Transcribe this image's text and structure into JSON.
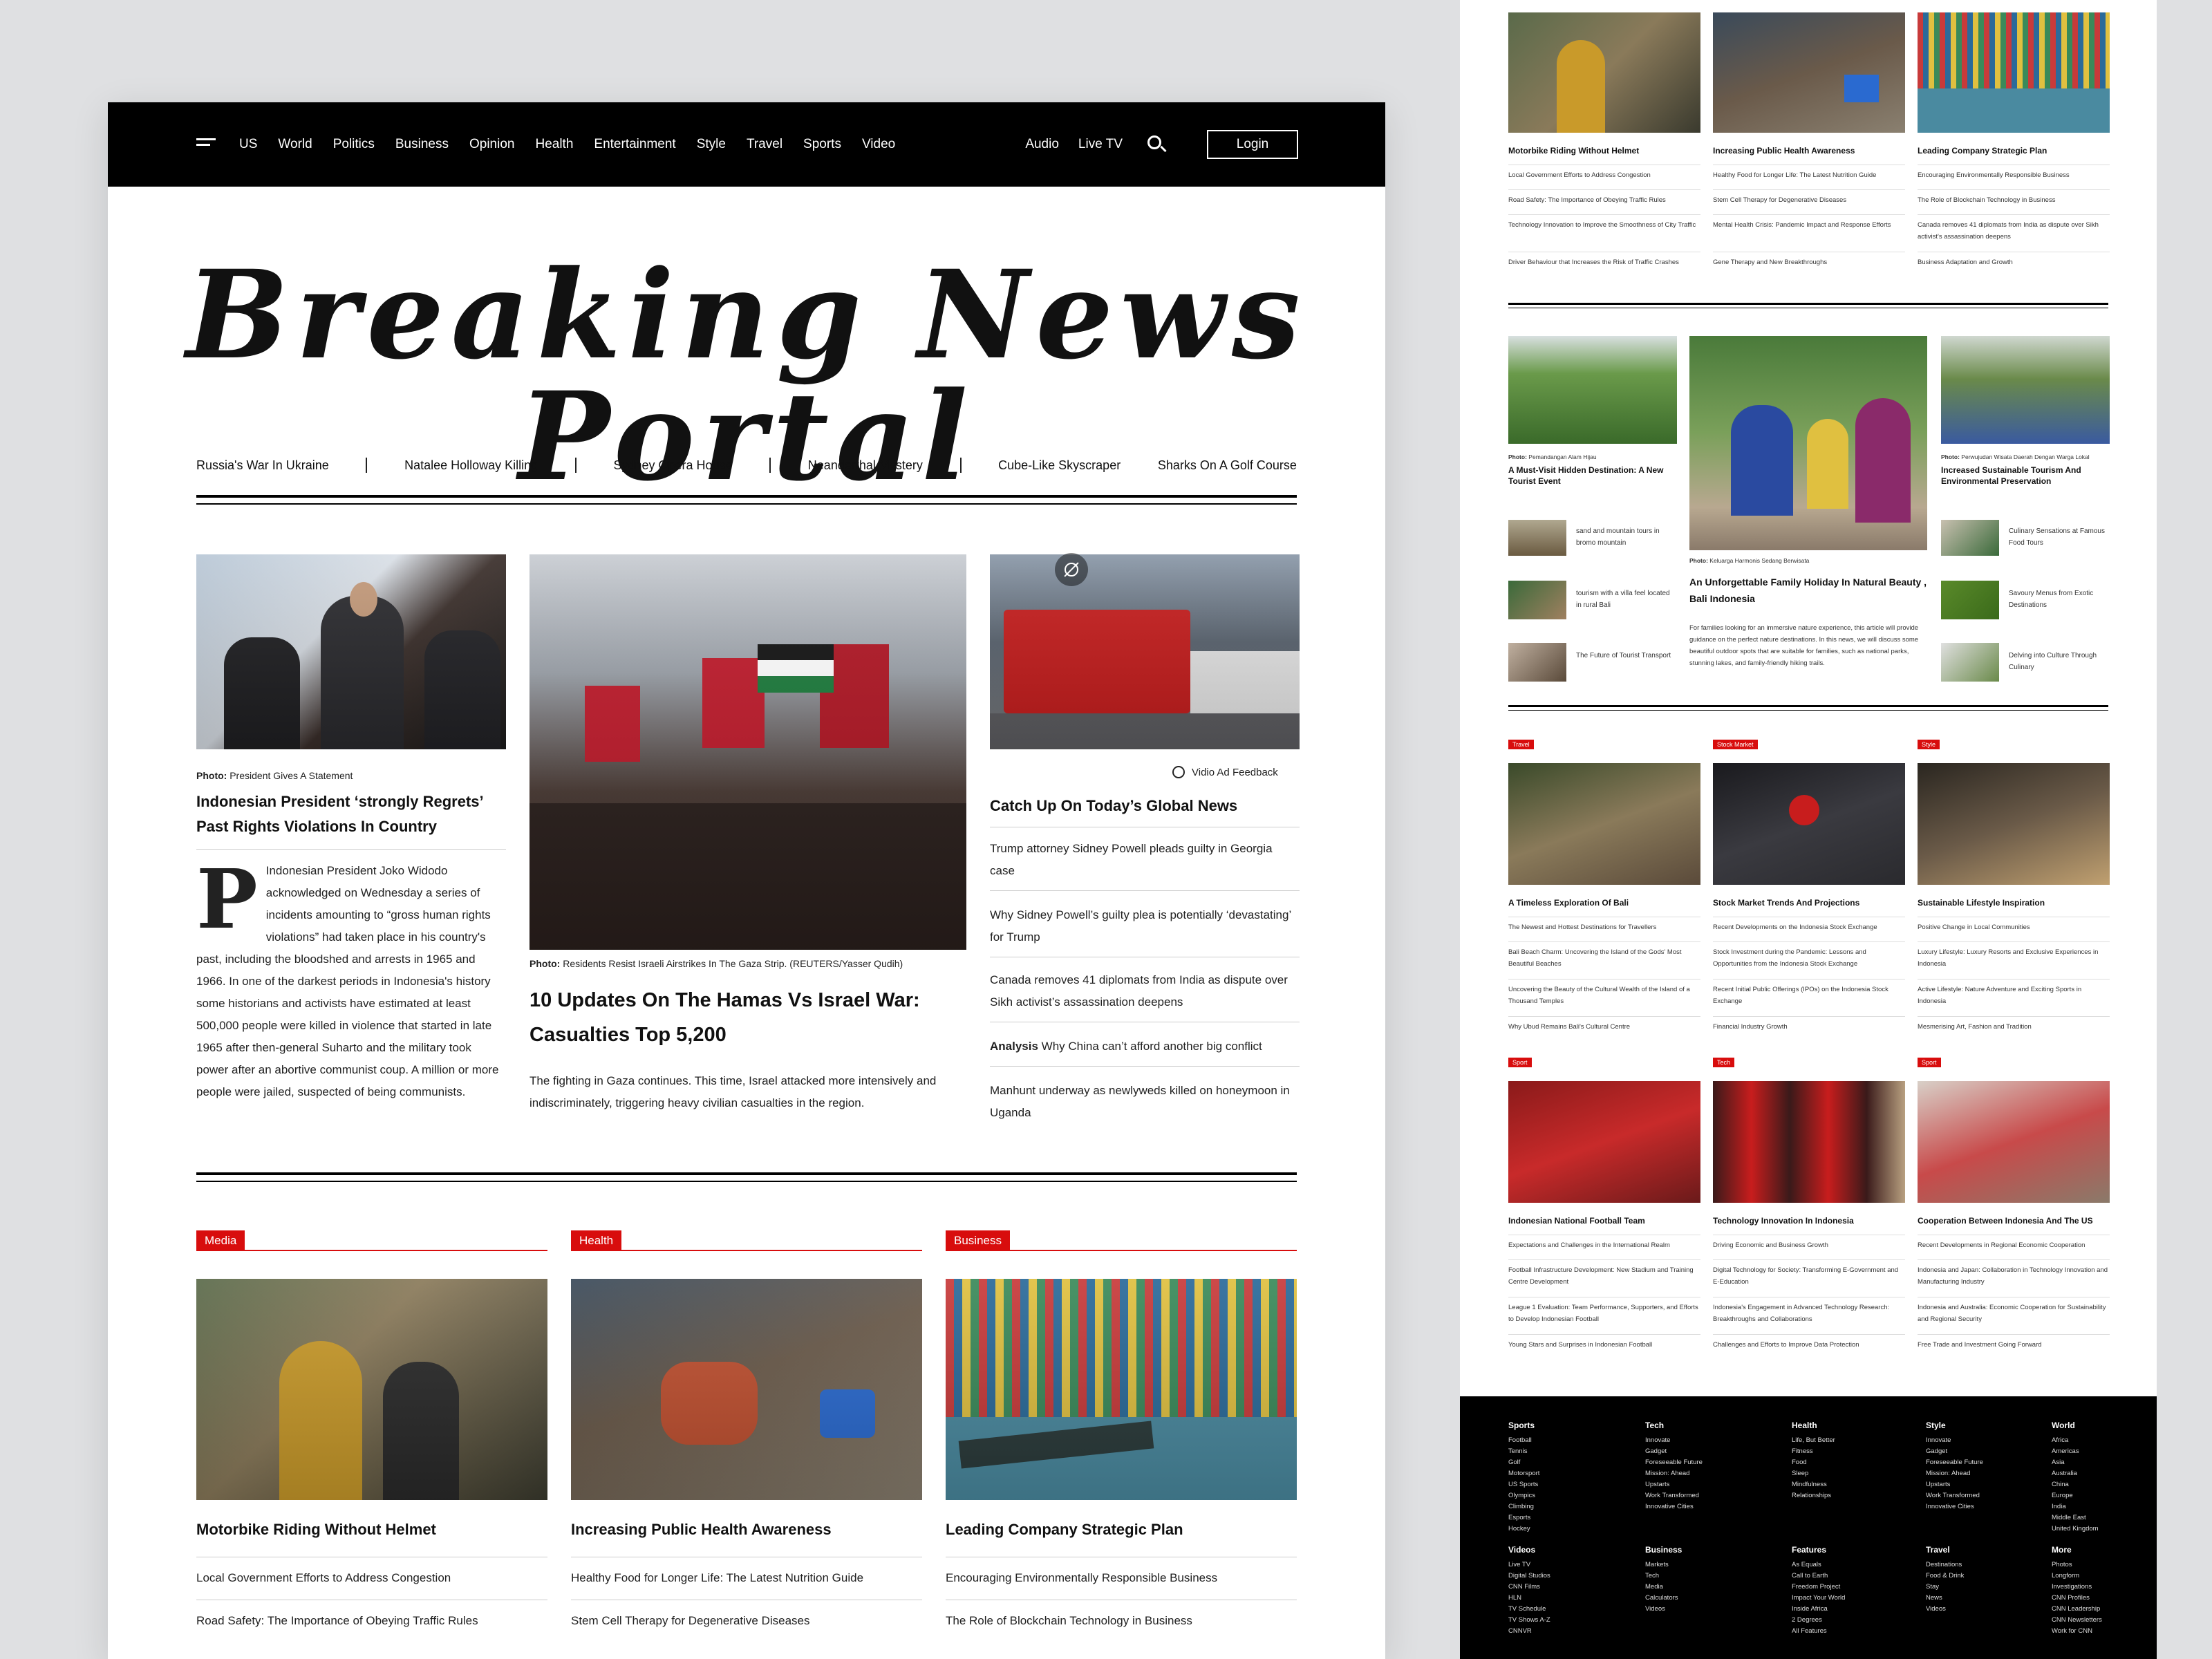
{
  "nav": {
    "links": [
      "US",
      "World",
      "Politics",
      "Business",
      "Opinion",
      "Health",
      "Entertainment",
      "Style",
      "Travel",
      "Sports",
      "Video"
    ],
    "right": [
      "Audio",
      "Live TV"
    ],
    "login": "Login"
  },
  "site_title": "Breaking News Portal",
  "trending": [
    "Russia's War In Ukraine",
    "Natalee Holloway Killing",
    "Sydney Opera House",
    "Neanderthal Mystery",
    "Cube-Like Skyscraper",
    "Sharks On A Golf Course"
  ],
  "story1": {
    "caption_label": "Photo:",
    "caption": "President Gives A Statement",
    "headline": "Indonesian President ‘strongly Regrets’ Past Rights Violations In Country",
    "dropcap": "P",
    "body": "Indonesian President Joko Widodo acknowledged on Wednesday a series of incidents amounting to “gross human rights violations” had taken place in his country's past, including the bloodshed and arrests in 1965 and 1966. In one of the darkest periods in Indonesia's history some historians and activists have estimated at least 500,000 people were killed in violence that started in late 1965 after then-general Suharto and the military took power after an abortive communist coup. A million or more people were jailed, suspected of being communists."
  },
  "story2": {
    "caption_label": "Photo:",
    "caption": "Residents Resist Israeli Airstrikes In The Gaza Strip. (REUTERS/Yasser Qudih)",
    "headline": "10 Updates On The Hamas Vs Israel War: Casualties Top 5,200",
    "body": "The fighting in Gaza continues. This time, Israel attacked more intensively and indiscriminately, triggering heavy civilian casualties in the region."
  },
  "story3": {
    "feedback": "Vidio Ad Feedback",
    "headline": "Catch Up On Today’s Global News",
    "items": [
      "Trump attorney Sidney Powell pleads guilty in Georgia case",
      "Why Sidney Powell’s guilty plea is potentially ‘devastating’ for Trump",
      "Canada removes 41 diplomats from India as dispute over Sikh activist’s assassination deepens",
      "Why China can’t afford another big conflict",
      "Manhunt underway as newlyweds killed on honeymoon in Uganda"
    ],
    "analysis_label": "Analysis"
  },
  "cards": [
    {
      "tag": "Media",
      "title": "Motorbike Riding Without Helmet",
      "items": [
        "Local Government Efforts to Address Congestion",
        "Road Safety: The Importance of Obeying Traffic Rules"
      ]
    },
    {
      "tag": "Health",
      "title": "Increasing Public Health Awareness",
      "items": [
        "Healthy Food for Longer Life: The Latest Nutrition Guide",
        "Stem Cell Therapy for Degenerative Diseases"
      ]
    },
    {
      "tag": "Business",
      "title": "Leading Company Strategic Plan",
      "items": [
        "Encouraging Environmentally Responsible Business",
        "The Role of Blockchain Technology in Business"
      ]
    }
  ],
  "right_top": [
    {
      "title": "Motorbike Riding Without Helmet",
      "items": [
        "Local Government Efforts to Address Congestion",
        "Road Safety: The Importance of Obeying Traffic Rules",
        "Technology Innovation to Improve the Smoothness of City Traffic",
        "Driver Behaviour that Increases the Risk of Traffic Crashes"
      ]
    },
    {
      "title": "Increasing Public Health Awareness",
      "items": [
        "Healthy Food for Longer Life: The Latest Nutrition Guide",
        "Stem Cell Therapy for Degenerative Diseases",
        "Mental Health Crisis: Pandemic Impact and Response Efforts",
        "Gene Therapy and New Breakthroughs"
      ]
    },
    {
      "title": "Leading Company Strategic Plan",
      "items": [
        "Encouraging Environmentally Responsible Business",
        "The Role of Blockchain Technology in Business",
        "Canada removes 41 diplomats from India as dispute over Sikh activist's assassination deepens",
        "Business Adaptation and Growth"
      ]
    }
  ],
  "travel": {
    "left": {
      "caption_label": "Photo:",
      "caption": "Pemandangan Alam Hijau",
      "title": "A Must-Visit Hidden Destination: A New Tourist Event",
      "items": [
        "sand and mountain tours in bromo mountain",
        "tourism with a villa feel located in rural Bali",
        "The Future of Tourist Transport"
      ]
    },
    "center": {
      "caption_label": "Photo:",
      "caption": "Keluarga Harmonis Sedang Berwisata",
      "title": "An Unforgettable Family Holiday In Natural Beauty , Bali Indonesia",
      "body": "For families looking for an immersive nature experience, this article will provide guidance on the perfect nature destinations. In this news, we will discuss some beautiful outdoor spots that are suitable for families, such as national parks, stunning lakes, and family-friendly hiking trails."
    },
    "right": {
      "caption_label": "Photo:",
      "caption": "Perwujudan Wisata Daerah Dengan Warga Lokal",
      "title": "Increased Sustainable Tourism And Environmental Preservation",
      "items": [
        "Culinary Sensations at Famous Food Tours",
        "Savoury Menus from Exotic Destinations",
        "Delving into Culture Through Culinary"
      ]
    }
  },
  "grid1": [
    {
      "tag": "Travel",
      "title": "A Timeless Exploration Of Bali",
      "items": [
        "The Newest and Hottest Destinations for Travellers",
        "Bali Beach Charm: Uncovering the Island of the Gods' Most Beautiful Beaches",
        "Uncovering the Beauty of the Cultural Wealth of the Island of a Thousand Temples",
        "Why Ubud Remains Bali's Cultural Centre"
      ]
    },
    {
      "tag": "Stock Market",
      "title": "Stock Market Trends And Projections",
      "items": [
        "Recent Developments on the Indonesia Stock Exchange",
        "Stock Investment during the Pandemic: Lessons and Opportunities from the Indonesia Stock Exchange",
        "Recent Initial Public Offerings (IPOs) on the Indonesia Stock Exchange",
        "Financial Industry Growth"
      ]
    },
    {
      "tag": "Style",
      "title": "Sustainable Lifestyle Inspiration",
      "items": [
        "Positive Change in Local Communities",
        "Luxury Lifestyle: Luxury Resorts and Exclusive Experiences in Indonesia",
        "Active Lifestyle: Nature Adventure and Exciting Sports in Indonesia",
        "Mesmerising Art, Fashion and Tradition"
      ]
    }
  ],
  "grid2": [
    {
      "tag": "Sport",
      "title": "Indonesian National Football Team",
      "items": [
        "Expectations and Challenges in the International Realm",
        "Football Infrastructure Development: New Stadium and Training Centre Development",
        "League 1 Evaluation: Team Performance, Supporters, and Efforts to Develop Indonesian Football",
        "Young Stars and Surprises in Indonesian Football"
      ]
    },
    {
      "tag": "Tech",
      "title": "Technology Innovation In Indonesia",
      "items": [
        "Driving Economic and Business Growth",
        "Digital Technology for Society: Transforming E-Government and E-Education",
        "Indonesia's Engagement in Advanced Technology Research: Breakthroughs and Collaborations",
        "Challenges and Efforts to Improve Data Protection"
      ]
    },
    {
      "tag": "Sport",
      "title": "Cooperation Between Indonesia And The US",
      "items": [
        "Recent Developments in Regional Economic Cooperation",
        "Indonesia and Japan: Collaboration in Technology Innovation and Manufacturing Industry",
        "Indonesia and Australia: Economic Cooperation for Sustainability and Regional Security",
        "Free Trade and Investment Going Forward"
      ]
    }
  ],
  "footer": [
    {
      "head": "Sports",
      "items": [
        "Football",
        "Tennis",
        "Golf",
        "Motorsport",
        "US Sports",
        "Olympics",
        "Climbing",
        "Esports",
        "Hockey"
      ]
    },
    {
      "head": "Tech",
      "items": [
        "Innovate",
        "Gadget",
        "Foreseeable Future",
        "Mission: Ahead",
        "Upstarts",
        "Work Transformed",
        "Innovative Cities"
      ]
    },
    {
      "head": "Health",
      "items": [
        "Life, But Better",
        "Fitness",
        "Food",
        "Sleep",
        "Mindfulness",
        "Relationships"
      ]
    },
    {
      "head": "Style",
      "items": [
        "Innovate",
        "Gadget",
        "Foreseeable Future",
        "Mission: Ahead",
        "Upstarts",
        "Work Transformed",
        "Innovative Cities"
      ]
    },
    {
      "head": "World",
      "items": [
        "Africa",
        "Americas",
        "Asia",
        "Australia",
        "China",
        "Europe",
        "India",
        "Middle East",
        "United Kingdom"
      ]
    },
    {
      "head": "Videos",
      "items": [
        "Live TV",
        "Digital Studios",
        "CNN Films",
        "HLN",
        "TV Schedule",
        "TV Shows A-Z",
        "CNNVR"
      ]
    },
    {
      "head": "Business",
      "items": [
        "Markets",
        "Tech",
        "Media",
        "Calculators",
        "Videos"
      ]
    },
    {
      "head": "Features",
      "items": [
        "As Equals",
        "Call to Earth",
        "Freedom Project",
        "Impact Your World",
        "Inside Africa",
        "2 Degrees",
        "All Features"
      ]
    },
    {
      "head": "Travel",
      "items": [
        "Destinations",
        "Food & Drink",
        "Stay",
        "News",
        "Videos"
      ]
    },
    {
      "head": "More",
      "items": [
        "Photos",
        "Longform",
        "Investigations",
        "CNN Profiles",
        "CNN Leadership",
        "CNN Newsletters",
        "Work for CNN"
      ]
    }
  ]
}
